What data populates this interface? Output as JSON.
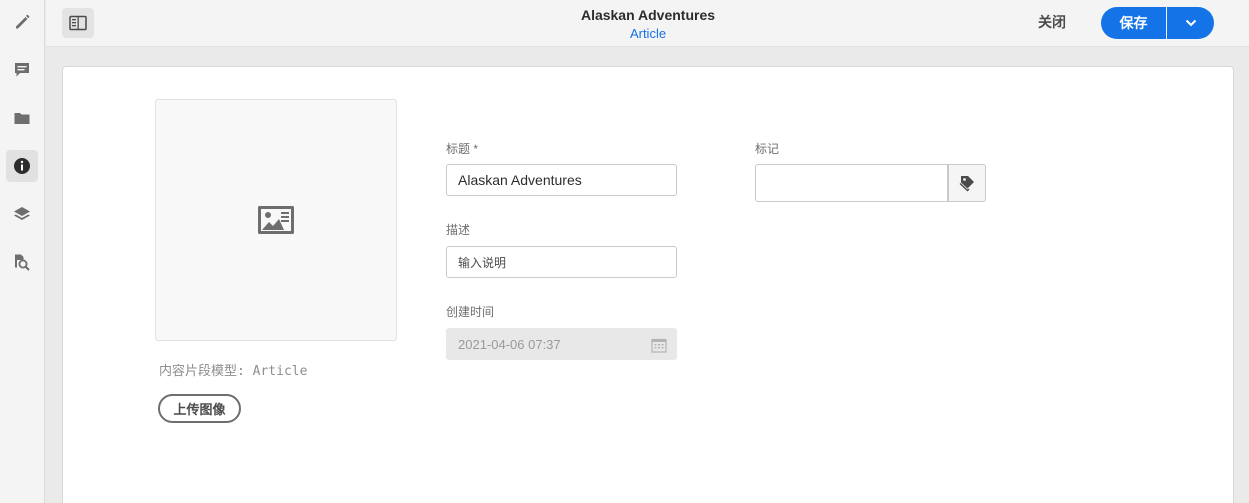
{
  "rail": {
    "items": [
      "edit",
      "comments",
      "folder",
      "info",
      "layers",
      "search-references"
    ],
    "active": "info"
  },
  "header": {
    "title": "Alaskan Adventures",
    "subtitle": "Article",
    "close_label": "关闭",
    "save_label": "保存"
  },
  "fragment": {
    "model_label": "内容片段模型: ",
    "model_value": "Article",
    "upload_label": "上传图像"
  },
  "form": {
    "title_label": "标题 *",
    "title_value": "Alaskan Adventures",
    "description_label": "描述",
    "description_placeholder": "输入说明",
    "created_label": "创建时间",
    "created_value": "2021-04-06 07:37",
    "tags_label": "标记",
    "tags_value": ""
  },
  "colors": {
    "accent": "#1473e6",
    "background": "#eaeaea",
    "card": "#ffffff"
  }
}
